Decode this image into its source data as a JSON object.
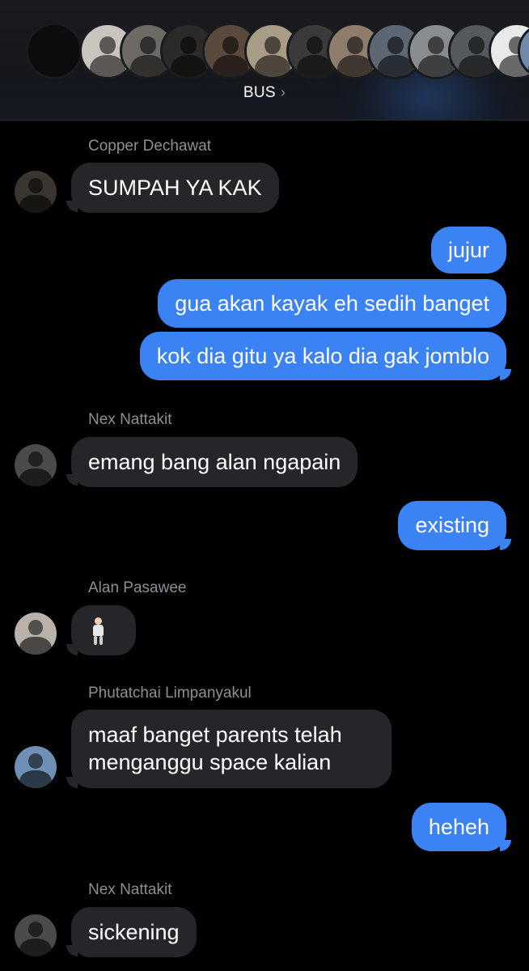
{
  "header": {
    "group_name": "BUS",
    "chevron": "›",
    "member_avatars": [
      {
        "color": "#0c0c0c"
      },
      {
        "color": "#c9c4bd"
      },
      {
        "color": "#6d6a66"
      },
      {
        "color": "#2b2a28"
      },
      {
        "color": "#5a4a3e"
      },
      {
        "color": "#a99c86"
      },
      {
        "color": "#3a3a3a"
      },
      {
        "color": "#8f7d6b"
      },
      {
        "color": "#5c6773"
      },
      {
        "color": "#8a8d90"
      },
      {
        "color": "#555a5e"
      },
      {
        "color": "#e9e9ea"
      },
      {
        "color": "#6f89a8"
      }
    ]
  },
  "messages": [
    {
      "type": "in",
      "sender": "Copper Dechawat",
      "text": "SUMPAH YA KAK",
      "avatar_color": "#3b3530"
    },
    {
      "type": "out",
      "text": "jujur"
    },
    {
      "type": "out",
      "text": "gua akan kayak eh sedih banget"
    },
    {
      "type": "out",
      "text": "kok dia gitu ya kalo dia gak jomblo"
    },
    {
      "type": "in",
      "sender": "Nex Nattakit",
      "text": "emang bang alan ngapain",
      "avatar_color": "#4a4a4a"
    },
    {
      "type": "out",
      "text": "existing"
    },
    {
      "type": "in",
      "sender": "Alan Pasawee",
      "emoji": "person-standing-emoji",
      "avatar_color": "#b8b2aa"
    },
    {
      "type": "in",
      "sender": "Phutatchai Limpanyakul",
      "lines": [
        "maaf banget parents telah",
        "menganggu space kalian"
      ],
      "avatar_color": "#6f8fb5"
    },
    {
      "type": "out",
      "text": "heheh"
    },
    {
      "type": "in",
      "sender": "Nex Nattakit",
      "text": "sickening",
      "avatar_color": "#4a4a4a"
    }
  ],
  "colors": {
    "incoming_bubble": "#26252a",
    "outgoing_bubble": "#3b82f5",
    "sender_name": "#8e8e93",
    "background": "#000000"
  }
}
